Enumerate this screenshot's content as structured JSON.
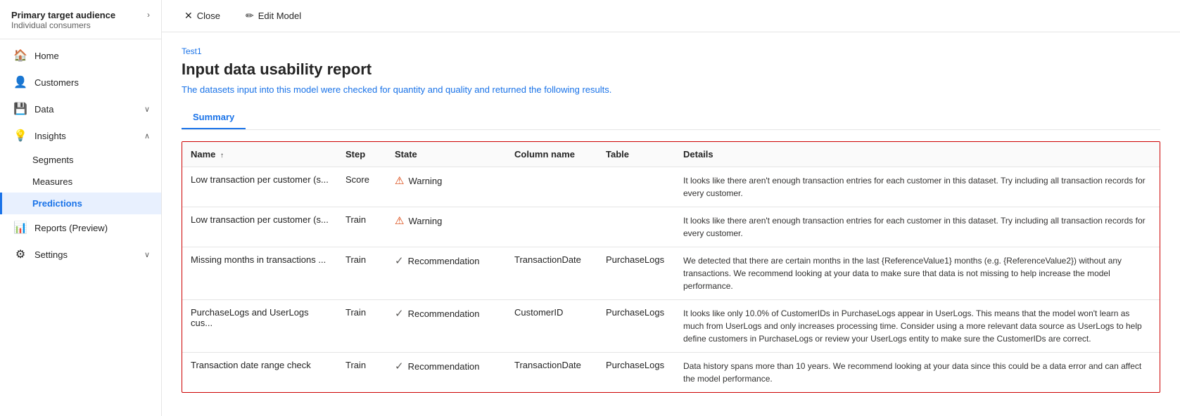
{
  "sidebar": {
    "header": {
      "title": "Primary target audience",
      "subtitle": "Individual consumers",
      "arrow": "›"
    },
    "items": [
      {
        "id": "home",
        "label": "Home",
        "icon": "🏠",
        "active": false,
        "hasChevron": false,
        "hasChildren": false
      },
      {
        "id": "customers",
        "label": "Customers",
        "icon": "👤",
        "active": false,
        "hasChevron": false,
        "hasChildren": false
      },
      {
        "id": "data",
        "label": "Data",
        "icon": "💾",
        "active": false,
        "hasChevron": true,
        "hasChildren": false
      },
      {
        "id": "insights",
        "label": "Insights",
        "icon": "💡",
        "active": false,
        "hasChevron": true,
        "expanded": true,
        "hasChildren": true
      },
      {
        "id": "segments",
        "label": "Segments",
        "icon": "",
        "active": false,
        "isChild": true
      },
      {
        "id": "measures",
        "label": "Measures",
        "icon": "",
        "active": false,
        "isChild": true
      },
      {
        "id": "predictions",
        "label": "Predictions",
        "icon": "",
        "active": true,
        "isChild": true
      },
      {
        "id": "reports",
        "label": "Reports (Preview)",
        "icon": "📊",
        "active": false,
        "hasChevron": false
      },
      {
        "id": "settings",
        "label": "Settings",
        "icon": "⚙",
        "active": false,
        "hasChevron": true
      }
    ]
  },
  "topbar": {
    "close_label": "Close",
    "close_icon": "✕",
    "edit_label": "Edit Model",
    "edit_icon": "✏"
  },
  "content": {
    "breadcrumb": "Test1",
    "title": "Input data usability report",
    "description": "The datasets input into this model were checked for quantity and quality and returned the following results.",
    "tabs": [
      {
        "id": "summary",
        "label": "Summary",
        "active": true
      }
    ],
    "table": {
      "columns": [
        {
          "id": "name",
          "label": "Name",
          "sortable": true,
          "sort": "↑"
        },
        {
          "id": "step",
          "label": "Step"
        },
        {
          "id": "state",
          "label": "State"
        },
        {
          "id": "column_name",
          "label": "Column name"
        },
        {
          "id": "table",
          "label": "Table"
        },
        {
          "id": "details",
          "label": "Details"
        }
      ],
      "rows": [
        {
          "name": "Low transaction per customer (s...",
          "step": "Score",
          "state_type": "warning",
          "state_label": "Warning",
          "column_name": "",
          "table": "",
          "details": "It looks like there aren't enough transaction entries for each customer in this dataset. Try including all transaction records for every customer."
        },
        {
          "name": "Low transaction per customer (s...",
          "step": "Train",
          "state_type": "warning",
          "state_label": "Warning",
          "column_name": "",
          "table": "",
          "details": "It looks like there aren't enough transaction entries for each customer in this dataset. Try including all transaction records for every customer."
        },
        {
          "name": "Missing months in transactions ...",
          "step": "Train",
          "state_type": "recommendation",
          "state_label": "Recommendation",
          "column_name": "TransactionDate",
          "table": "PurchaseLogs",
          "details": "We detected that there are certain months in the last {ReferenceValue1} months (e.g. {ReferenceValue2}) without any transactions. We recommend looking at your data to make sure that data is not missing to help increase the model performance."
        },
        {
          "name": "PurchaseLogs and UserLogs cus...",
          "step": "Train",
          "state_type": "recommendation",
          "state_label": "Recommendation",
          "column_name": "CustomerID",
          "table": "PurchaseLogs",
          "details": "It looks like only 10.0% of CustomerIDs in PurchaseLogs appear in UserLogs. This means that the model won't learn as much from UserLogs and only increases processing time. Consider using a more relevant data source as UserLogs to help define customers in PurchaseLogs or review your UserLogs entity to make sure the CustomerIDs are correct."
        },
        {
          "name": "Transaction date range check",
          "step": "Train",
          "state_type": "recommendation",
          "state_label": "Recommendation",
          "column_name": "TransactionDate",
          "table": "PurchaseLogs",
          "details": "Data history spans more than 10 years. We recommend looking at your data since this could be a data error and can affect the model performance."
        }
      ]
    }
  }
}
